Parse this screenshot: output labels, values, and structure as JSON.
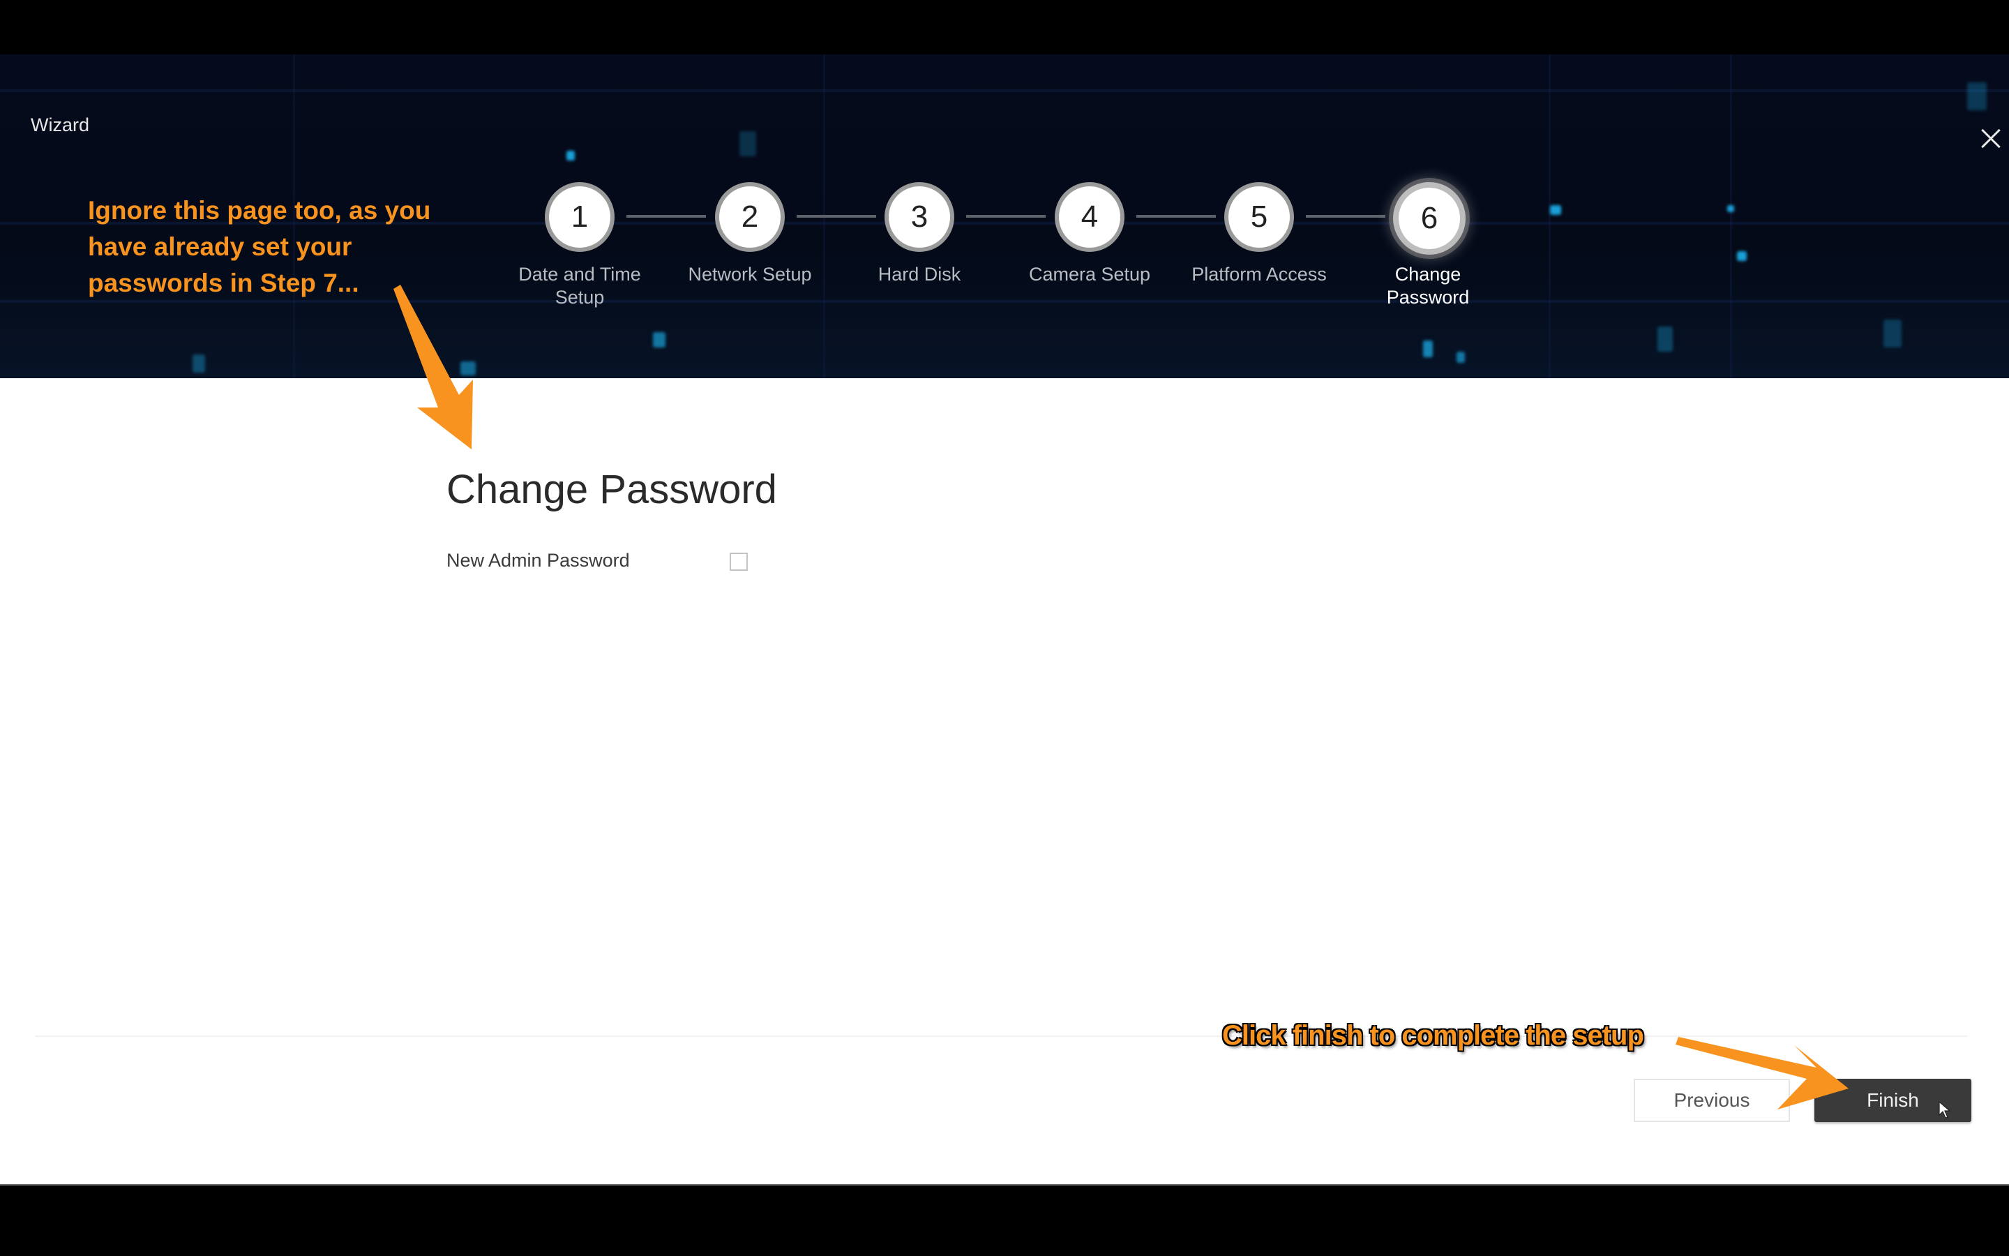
{
  "window": {
    "title": "Wizard",
    "close_icon": "close-icon"
  },
  "steps": [
    {
      "number": "1",
      "label": "Date and Time Setup",
      "state": "completed"
    },
    {
      "number": "2",
      "label": "Network Setup",
      "state": "completed"
    },
    {
      "number": "3",
      "label": "Hard Disk",
      "state": "completed"
    },
    {
      "number": "4",
      "label": "Camera Setup",
      "state": "completed"
    },
    {
      "number": "5",
      "label": "Platform Access",
      "state": "completed"
    },
    {
      "number": "6",
      "label": "Change Password",
      "state": "active"
    }
  ],
  "main": {
    "title": "Change Password",
    "fields": [
      {
        "label": "New Admin Password",
        "type": "checkbox",
        "checked": false
      }
    ]
  },
  "footer": {
    "previous_label": "Previous",
    "finish_label": "Finish"
  },
  "annotations": {
    "top_note": "Ignore this page too, as you have already set your passwords in Step 7...",
    "bottom_note": "Click finish to complete the setup",
    "color": "#f7931e"
  },
  "colors": {
    "header_bg": "#050b1c",
    "finish_bg": "#3a3a3a",
    "accent_dots": "#1aa0d8"
  }
}
